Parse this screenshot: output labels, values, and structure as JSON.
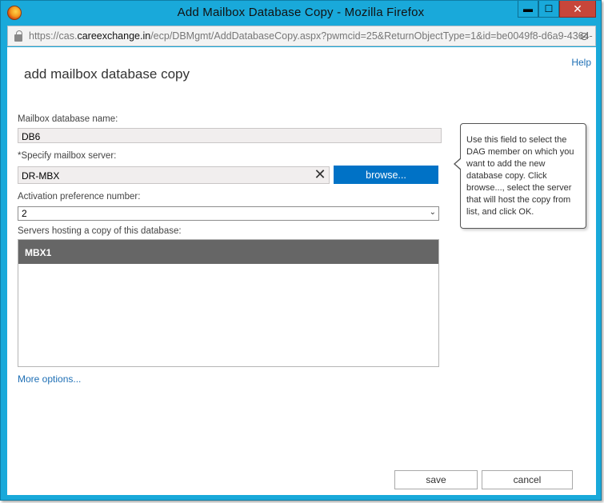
{
  "window": {
    "title": "Add Mailbox Database Copy - Mozilla Firefox",
    "minimize_label": "▬",
    "maximize_label": "☐",
    "close_label": "✕"
  },
  "urlbar": {
    "prefix": "https://cas.",
    "domain": "careexchange.in",
    "path": "/ecp/DBMgmt/AddDatabaseCopy.aspx?pwmcid=25&ReturnObjectType=1&id=be0049f8-d6a9-4364-",
    "extra": "⊘"
  },
  "page": {
    "help": "Help",
    "title": "add mailbox database copy"
  },
  "form": {
    "db_name_label": "Mailbox database name:",
    "db_name_value": "DB6",
    "server_label": "*Specify mailbox server:",
    "server_value": "DR-MBX",
    "clear_label": "✕",
    "browse_label": "browse...",
    "activation_label": "Activation preference number:",
    "activation_value": "2",
    "activation_arrow": "⌄",
    "servers_label": "Servers hosting a copy of this database:",
    "servers": [
      {
        "name": "MBX1"
      }
    ],
    "more_options": "More options..."
  },
  "callout": {
    "text": "Use this field to select the DAG member on which you want to add the new database copy. Click browse..., select the server that will host the copy from list, and click OK."
  },
  "actions": {
    "save": "save",
    "cancel": "cancel"
  }
}
